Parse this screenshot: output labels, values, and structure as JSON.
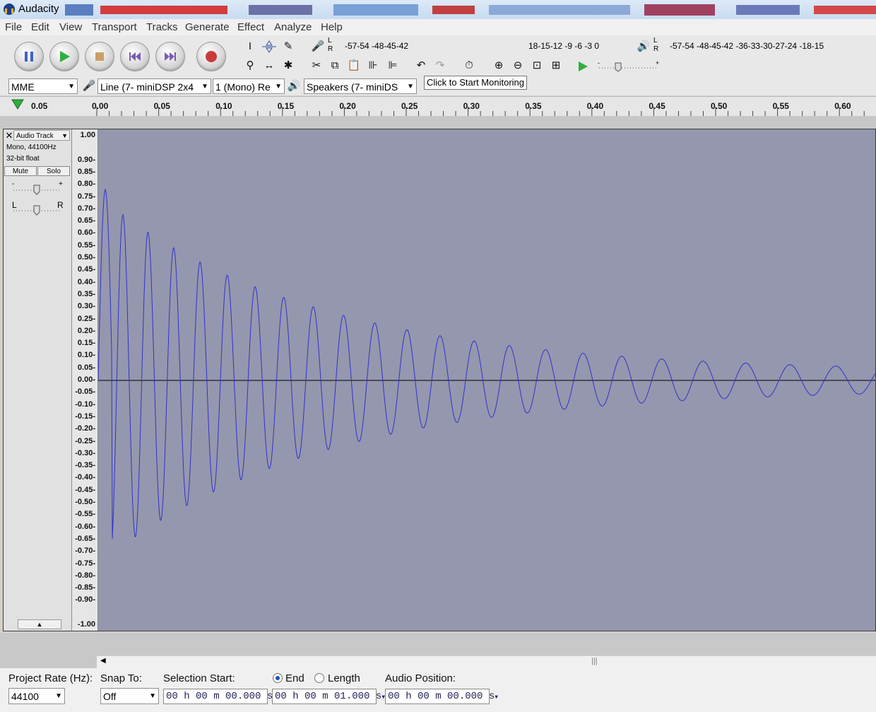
{
  "window": {
    "title": "Audacity"
  },
  "menu": [
    "File",
    "Edit",
    "View",
    "Transport",
    "Tracks",
    "Generate",
    "Effect",
    "Analyze",
    "Help"
  ],
  "meters": {
    "record_scale": "-57-54     -48-45-42",
    "record_scale_tail": "18-15-12  -9  -6  -3  0",
    "tooltip": "Click to Start Monitoring",
    "play_scale": "-57-54     -48-45-42     -36-33-30-27-24     -18-15",
    "lr_l": "L",
    "lr_r": "R"
  },
  "device": {
    "host": "MME",
    "input": "Line (7- miniDSP 2x4",
    "channels": "1 (Mono) Re",
    "output": "Speakers (7- miniDS"
  },
  "ruler": {
    "start_label": "0.05",
    "ticks": [
      "0.00",
      "0.05",
      "0.10",
      "0.15",
      "0.20",
      "0.25",
      "0.30",
      "0.35",
      "0.40",
      "0.45",
      "0.50",
      "0.55",
      "0.60"
    ]
  },
  "track": {
    "name": "Audio Track",
    "format": "Mono, 44100Hz",
    "bits": "32-bit float",
    "mute": "Mute",
    "solo": "Solo",
    "gain_minus": "-",
    "gain_plus": "+",
    "pan_left": "L",
    "pan_right": "R"
  },
  "vscale": [
    "1.00",
    "0.90-",
    "0.85-",
    "0.80-",
    "0.75-",
    "0.70-",
    "0.65-",
    "0.60-",
    "0.55-",
    "0.50-",
    "0.45-",
    "0.40-",
    "0.35-",
    "0.30-",
    "0.25-",
    "0.20-",
    "0.15-",
    "0.10-",
    "0.05-",
    "0.00-",
    "-0.05-",
    "-0.10-",
    "-0.15-",
    "-0.20-",
    "-0.25-",
    "-0.30-",
    "-0.35-",
    "-0.40-",
    "-0.45-",
    "-0.50-",
    "-0.55-",
    "-0.60-",
    "-0.65-",
    "-0.70-",
    "-0.75-",
    "-0.80-",
    "-0.85-",
    "-0.90-",
    "-1.00"
  ],
  "status": {
    "rate_label": "Project Rate (Hz):",
    "rate_value": "44100",
    "snap_label": "Snap To:",
    "snap_value": "Off",
    "sel_start_label": "Selection Start:",
    "end_label": "End",
    "length_label": "Length",
    "audio_pos_label": "Audio Position:",
    "sel_start_value": "00 h 00 m 00.000 s",
    "end_value": "00 h 00 m 01.000 s",
    "audio_pos_value": "00 h 00 m 00.000 s",
    "end_selected": true
  },
  "colors": {
    "waveform": "#3232c8",
    "wave_bg": "#9597ae",
    "record": "#c83c3c",
    "play": "#2fae3f",
    "pause": "#3c64c8"
  }
}
